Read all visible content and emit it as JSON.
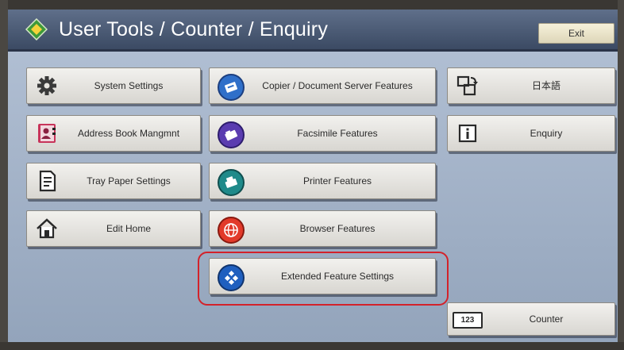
{
  "header": {
    "title": "User Tools / Counter / Enquiry",
    "exit_label": "Exit"
  },
  "left_column": [
    {
      "label": "System Settings",
      "icon": "gear-icon"
    },
    {
      "label": "Address Book Mangmnt",
      "icon": "address-book-icon"
    },
    {
      "label": "Tray Paper Settings",
      "icon": "tray-paper-icon"
    },
    {
      "label": "Edit Home",
      "icon": "home-icon"
    }
  ],
  "middle_column": [
    {
      "label": "Copier / Document Server Features",
      "icon": "copier-icon"
    },
    {
      "label": "Facsimile Features",
      "icon": "facsimile-icon"
    },
    {
      "label": "Printer Features",
      "icon": "printer-icon"
    },
    {
      "label": "Browser Features",
      "icon": "browser-icon"
    },
    {
      "label": "Extended Feature Settings",
      "icon": "extended-feature-icon"
    }
  ],
  "right_column": [
    {
      "label": "日本語",
      "icon": "language-switch-icon"
    },
    {
      "label": "Enquiry",
      "icon": "info-icon"
    }
  ],
  "counter": {
    "label": "Counter",
    "badge": "123"
  },
  "colors": {
    "highlight": "#d3222a",
    "title_bar": "#3b4a63",
    "screen_bg": "#a7b6cb"
  }
}
